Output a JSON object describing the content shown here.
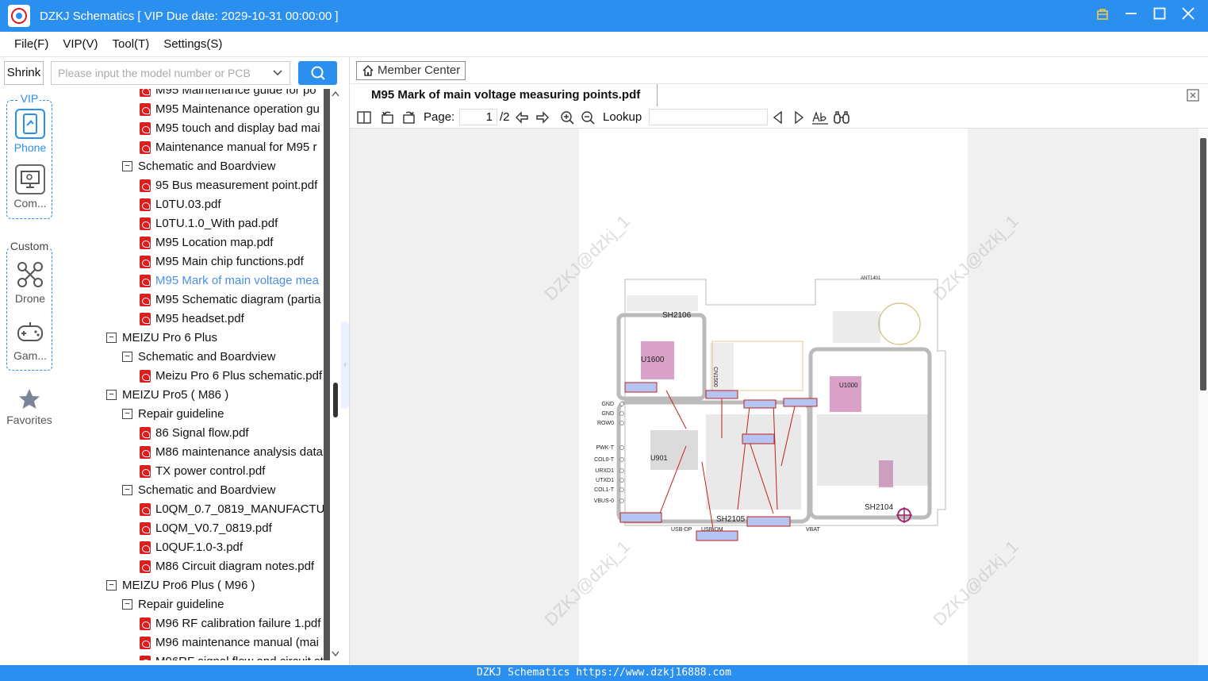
{
  "window": {
    "title": "DZKJ Schematics [ VIP Due date: 2029-10-31 00:00:00 ]",
    "controls": [
      "lock-icon",
      "minimize-icon",
      "maximize-icon",
      "close-icon"
    ]
  },
  "menu": [
    "File(F)",
    "VIP(V)",
    "Tool(T)",
    "Settings(S)"
  ],
  "search": {
    "shrink_label": "Shrink",
    "placeholder": "Please input the model number or PCB"
  },
  "sidebar": {
    "vip_label": "VIP",
    "custom_label": "Custom",
    "items": [
      {
        "label": "Phone",
        "icon": "phone-icon"
      },
      {
        "label": "Com...",
        "icon": "computer-icon"
      },
      {
        "label": "Drone",
        "icon": "drone-icon"
      },
      {
        "label": "Gam...",
        "icon": "gamepad-icon"
      }
    ],
    "favorites_label": "Favorites"
  },
  "tree": [
    {
      "level": 2,
      "type": "pdf",
      "label": "M95 Maintenance guide for po"
    },
    {
      "level": 2,
      "type": "pdf",
      "label": "M95 Maintenance operation gu"
    },
    {
      "level": 2,
      "type": "pdf",
      "label": "M95 touch and display bad mai"
    },
    {
      "level": 2,
      "type": "pdf",
      "label": "Maintenance manual for M95 r"
    },
    {
      "level": 1,
      "type": "folder",
      "label": "Schematic and Boardview"
    },
    {
      "level": 2,
      "type": "pdf",
      "label": "95 Bus measurement point.pdf"
    },
    {
      "level": 2,
      "type": "pdf",
      "label": "L0TU.03.pdf"
    },
    {
      "level": 2,
      "type": "pdf",
      "label": "L0TU.1.0_With pad.pdf"
    },
    {
      "level": 2,
      "type": "pdf",
      "label": "M95 Location map.pdf"
    },
    {
      "level": 2,
      "type": "pdf",
      "label": "M95 Main chip functions.pdf"
    },
    {
      "level": 2,
      "type": "pdf",
      "label": "M95 Mark of main voltage mea",
      "selected": true
    },
    {
      "level": 2,
      "type": "pdf",
      "label": "M95 Schematic diagram (partia"
    },
    {
      "level": 2,
      "type": "pdf",
      "label": "M95 headset.pdf"
    },
    {
      "level": 0,
      "type": "folder",
      "label": "MEIZU Pro 6 Plus"
    },
    {
      "level": 1,
      "type": "folder",
      "label": "Schematic and Boardview"
    },
    {
      "level": 2,
      "type": "pdf",
      "label": "Meizu Pro 6 Plus schematic.pdf"
    },
    {
      "level": 0,
      "type": "folder",
      "label": "MEIZU Pro5 ( M86 )"
    },
    {
      "level": 1,
      "type": "folder",
      "label": "Repair guideline"
    },
    {
      "level": 2,
      "type": "pdf",
      "label": "86 Signal flow.pdf"
    },
    {
      "level": 2,
      "type": "pdf",
      "label": "M86 maintenance analysis data"
    },
    {
      "level": 2,
      "type": "pdf",
      "label": "TX power control.pdf"
    },
    {
      "level": 1,
      "type": "folder",
      "label": "Schematic and Boardview"
    },
    {
      "level": 2,
      "type": "pdf",
      "label": "L0QM_0.7_0819_MANUFACTURE"
    },
    {
      "level": 2,
      "type": "pdf",
      "label": "L0QM_V0.7_0819.pdf"
    },
    {
      "level": 2,
      "type": "pdf",
      "label": "L0QUF.1.0-3.pdf"
    },
    {
      "level": 2,
      "type": "pdf",
      "label": "M86 Circuit diagram notes.pdf"
    },
    {
      "level": 0,
      "type": "folder",
      "label": "MEIZU Pro6 Plus ( M96 )"
    },
    {
      "level": 1,
      "type": "folder",
      "label": "Repair guideline"
    },
    {
      "level": 2,
      "type": "pdf",
      "label": "M96 RF calibration failure 1.pdf"
    },
    {
      "level": 2,
      "type": "pdf",
      "label": "M96 maintenance manual (mai"
    },
    {
      "level": 2,
      "type": "pdf",
      "label": "M96RF signal flow and circuit st"
    }
  ],
  "viewer": {
    "member_center": "Member Center",
    "tab_title": "M95 Mark of main voltage measuring points.pdf",
    "page_label": "Page:",
    "page_current": "1",
    "page_total": "/2",
    "lookup_label": "Lookup",
    "lookup_value": "",
    "watermark": "DZKJ@dzkj_1",
    "board_labels": [
      "SH2106",
      "SH2104",
      "SH2105",
      "U1600",
      "U1000",
      "U901",
      "CN1500",
      "ANT1401",
      "GND",
      "GND",
      "ROW0",
      "PWK-T",
      "COL0-T",
      "URXD1",
      "UTXD1",
      "COL1-T",
      "VBUS-0",
      "USB-DP",
      "USB-DM",
      "VBAT"
    ]
  },
  "status_bar": "DZKJ Schematics https://www.dzkj16888.com",
  "colors": {
    "accent": "#2b8ff0",
    "pdf_red": "#d81e1e",
    "selected_text": "#4a90e2"
  }
}
